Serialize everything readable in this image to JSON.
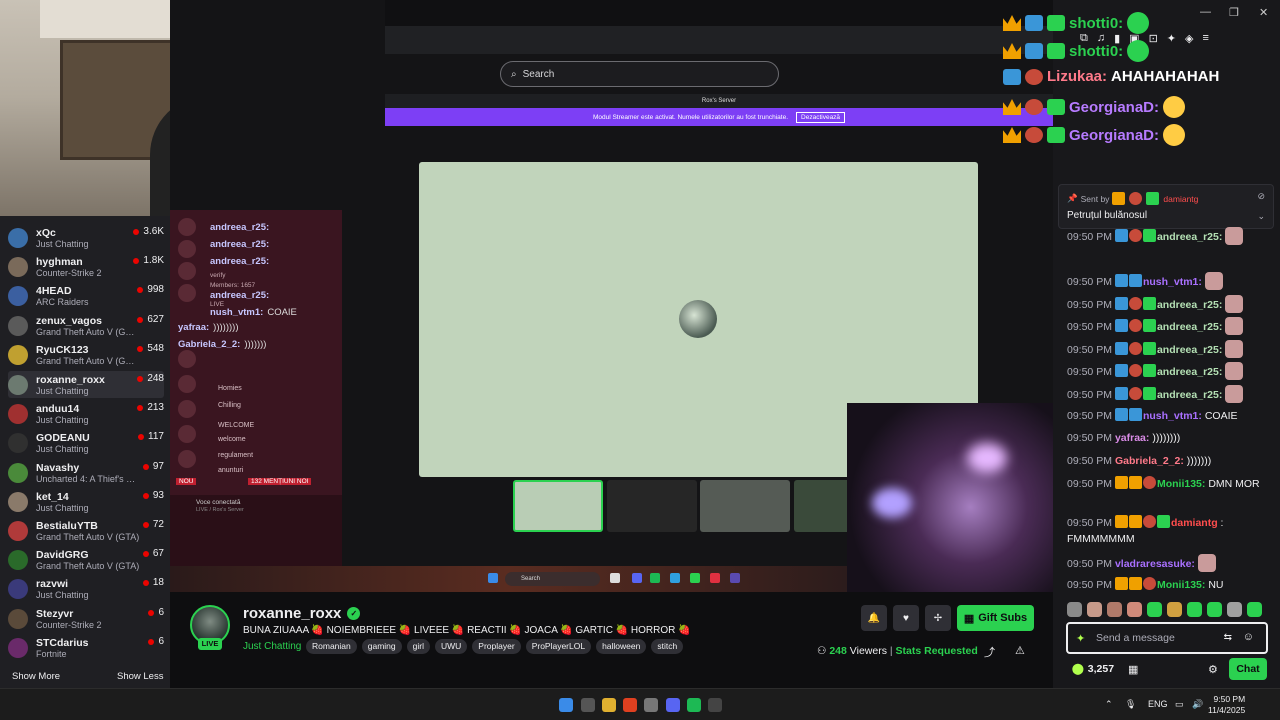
{
  "sidebar": {
    "channels": [
      {
        "name": "xQc",
        "game": "Just Chatting",
        "viewers": "3.6K",
        "color": "#3a6ea8"
      },
      {
        "name": "hyghman",
        "game": "Counter-Strike 2",
        "viewers": "1.8K",
        "color": "#7a6a5a"
      },
      {
        "name": "4HEAD",
        "game": "ARC Raiders",
        "viewers": "998",
        "color": "#3b5fa0"
      },
      {
        "name": "zenux_vagos",
        "game": "Grand Theft Auto V (G…",
        "viewers": "627",
        "color": "#5a5a5a"
      },
      {
        "name": "RyuCK123",
        "game": "Grand Theft Auto V (G…",
        "viewers": "548",
        "color": "#c0a030"
      },
      {
        "name": "roxanne_roxx",
        "game": "Just Chatting",
        "viewers": "248",
        "color": "#6c7a70"
      },
      {
        "name": "anduu14",
        "game": "Just Chatting",
        "viewers": "213",
        "color": "#a03030"
      },
      {
        "name": "GODEANU",
        "game": "Just Chatting",
        "viewers": "117",
        "color": "#303030"
      },
      {
        "name": "Navashy",
        "game": "Uncharted 4: A Thief's …",
        "viewers": "97",
        "color": "#4a8a3a"
      },
      {
        "name": "ket_14",
        "game": "Just Chatting",
        "viewers": "93",
        "color": "#8a7a6a"
      },
      {
        "name": "BestialuYTB",
        "game": "Grand Theft Auto V (GTA)",
        "viewers": "72",
        "color": "#b03a3a"
      },
      {
        "name": "DavidGRG",
        "game": "Grand Theft Auto V (GTA)",
        "viewers": "67",
        "color": "#2a6a2a"
      },
      {
        "name": "razvwi",
        "game": "Just Chatting",
        "viewers": "18",
        "color": "#3a3a7a"
      },
      {
        "name": "Stezyvr",
        "game": "Counter-Strike 2",
        "viewers": "6",
        "color": "#5a4a3a"
      },
      {
        "name": "STCdarius",
        "game": "Fortnite",
        "viewers": "6",
        "color": "#6a2a6a"
      }
    ],
    "show_more": "Show More",
    "show_less": "Show Less"
  },
  "stream_content": {
    "search_placeholder": "Search",
    "discord_server": "Rox's Server",
    "streamer_mode_text": "Modul Streamer este activat. Numele utilizatorilor au fost trunchiate.",
    "streamer_mode_btn": "Dezactivează",
    "discord_chat": [
      {
        "user": "andreea_r25:",
        "text": ""
      },
      {
        "user": "andreea_r25:",
        "text": ""
      },
      {
        "user": "andreea_r25:",
        "text": ""
      },
      {
        "user": "andreea_r25:",
        "text": ""
      },
      {
        "user": "nush_vtm1:",
        "text": "COAIE"
      },
      {
        "user": "yafraa:",
        "text": "))))))))"
      },
      {
        "user": "Gabriela_2_2:",
        "text": ")))))))"
      }
    ],
    "discord_small": [
      "verify",
      "Members: 1657",
      "LIVE"
    ],
    "discord_channels": [
      "Homies",
      "Chilling",
      "WELCOME",
      "welcome",
      "regulament",
      "anunturi"
    ],
    "voice_connected": "Voce conectată",
    "voice_where": "LIVE / Rox's Server",
    "new_mentions": "132 MENȚIUNI NOI",
    "new_badge": "NOU",
    "taskbar_search": "Search"
  },
  "overlay_chat": [
    {
      "user": "shotti0:",
      "color": "#2bd150",
      "text": ""
    },
    {
      "user": "shotti0:",
      "color": "#2bd150",
      "text": ""
    },
    {
      "user": "Lizukaa:",
      "color": "#ff7a8a",
      "text": "AHAHAHAHAH"
    },
    {
      "user": "GeorgianaD:",
      "color": "#b77bff",
      "text": ""
    },
    {
      "user": "GeorgianaD:",
      "color": "#b77bff",
      "text": ""
    }
  ],
  "pinned": {
    "sent_by": "Sent by",
    "sender": "damiantg",
    "message": "Petruțul bulănosul"
  },
  "chat": {
    "messages": [
      {
        "time": "09:50 PM",
        "user": "andreea_r25:",
        "color": "#b4e0b4",
        "text": ""
      },
      {
        "time": "09:50 PM",
        "user": "nush_vtm1:",
        "color": "#a970ff",
        "text": ""
      },
      {
        "time": "09:50 PM",
        "user": "andreea_r25:",
        "color": "#b4e0b4",
        "text": ""
      },
      {
        "time": "09:50 PM",
        "user": "andreea_r25:",
        "color": "#b4e0b4",
        "text": ""
      },
      {
        "time": "09:50 PM",
        "user": "andreea_r25:",
        "color": "#b4e0b4",
        "text": ""
      },
      {
        "time": "09:50 PM",
        "user": "andreea_r25:",
        "color": "#b4e0b4",
        "text": ""
      },
      {
        "time": "09:50 PM",
        "user": "andreea_r25:",
        "color": "#b4e0b4",
        "text": ""
      },
      {
        "time": "09:50 PM",
        "user": "nush_vtm1:",
        "color": "#a970ff",
        "text": "COAIE"
      },
      {
        "time": "09:50 PM",
        "user": "yafraa:",
        "color": "#d98be6",
        "text": "))))))))"
      },
      {
        "time": "09:50 PM",
        "user": "Gabriela_2_2:",
        "color": "#ff7a8a",
        "text": ")))))))"
      },
      {
        "time": "09:50 PM",
        "user": "Monii135:",
        "color": "#2bd150",
        "text": "DMN MOR"
      },
      {
        "time": "09:50 PM",
        "user": "damiantg",
        "color": "#ff4d4d",
        "text": ": FMMMMMMM"
      },
      {
        "time": "09:50 PM",
        "user": "vladraresasuke:",
        "color": "#a970ff",
        "text": ""
      },
      {
        "time": "09:50 PM",
        "user": "Monii135:",
        "color": "#2bd150",
        "text": "NU"
      }
    ],
    "input_placeholder": "Send a message",
    "points": "3,257",
    "chat_button": "Chat"
  },
  "stream_info": {
    "channel_name": "roxanne_roxx",
    "live": "LIVE",
    "title": "BUNA ZIUAAA 🍓 NOIEMBRIEEE 🍓 LIVEEE 🍓 REACTII 🍓 JOACA 🍓 GARTIC 🍓 HORROR 🍓",
    "category": "Just Chatting",
    "tags": [
      "Romanian",
      "gaming",
      "girl",
      "UWU",
      "Proplayer",
      "ProPlayerLOL",
      "halloween",
      "stitch"
    ],
    "gift_subs": "Gift Subs",
    "viewers": "248",
    "viewers_label": "Viewers",
    "stats_requested": "Stats Requested"
  },
  "taskbar": {
    "lang": "ENG",
    "time": "9:50 PM",
    "date": "11/4/2025"
  }
}
